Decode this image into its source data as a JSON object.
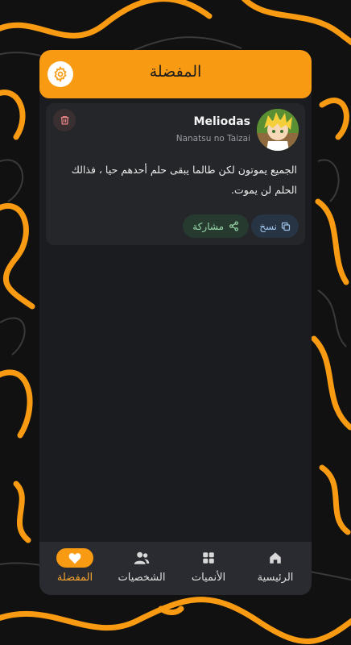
{
  "header": {
    "title": "المفضلة"
  },
  "favorite": {
    "character_name": "Meliodas",
    "anime_name": "Nanatsu no Taizai",
    "quote": "الجميع يموتون لكن طالما يبقى حلم أحدهم حيا ، فذالك الحلم لن يموت.",
    "copy_label": "نسخ",
    "share_label": "مشاركة"
  },
  "bottom_nav": {
    "items": [
      {
        "label": "الرئيسية",
        "icon": "home-icon",
        "active": false
      },
      {
        "label": "الأنميات",
        "icon": "grid-icon",
        "active": false
      },
      {
        "label": "الشخصيات",
        "icon": "people-icon",
        "active": false
      },
      {
        "label": "المفضلة",
        "icon": "heart-icon",
        "active": true
      }
    ]
  },
  "colors": {
    "accent": "#f99b12",
    "surface": "#1b1c1f",
    "card": "#25262a",
    "nav": "#2a2b30"
  }
}
